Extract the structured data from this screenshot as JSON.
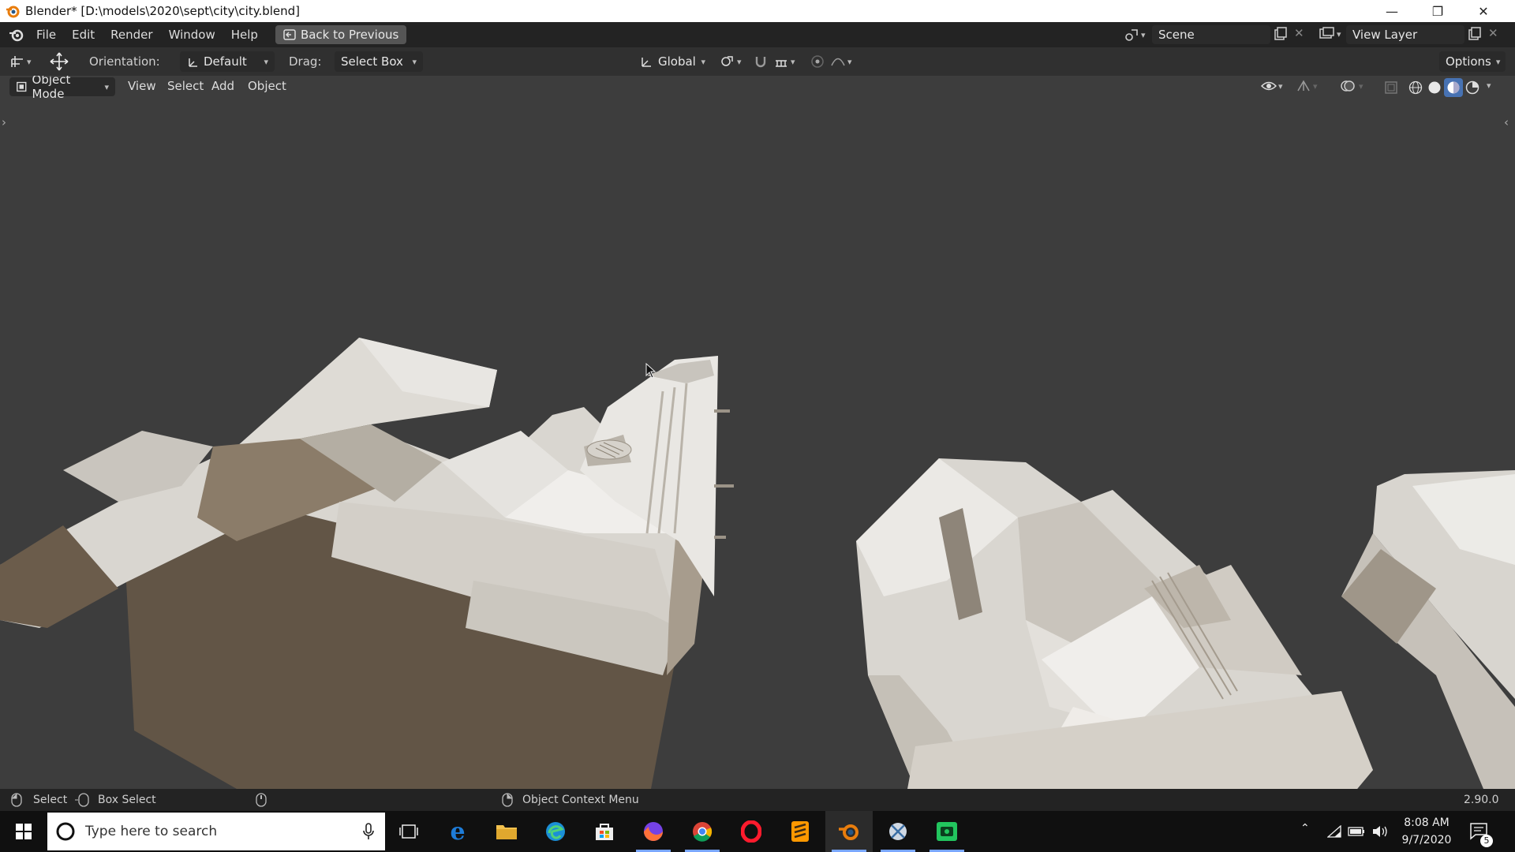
{
  "window": {
    "title": "Blender* [D:\\models\\2020\\sept\\city\\city.blend]"
  },
  "menu": {
    "items": [
      "File",
      "Edit",
      "Render",
      "Window",
      "Help"
    ],
    "back_label": "Back to Previous"
  },
  "scene": {
    "name": "Scene",
    "view_layer": "View Layer"
  },
  "tool_header": {
    "orientation_label": "Orientation:",
    "orientation_value": "Default",
    "drag_label": "Drag:",
    "drag_value": "Select Box",
    "transform_orientation": "Global",
    "options_label": "Options"
  },
  "viewport_header": {
    "mode": "Object Mode",
    "menus": [
      "View",
      "Select",
      "Add",
      "Object"
    ]
  },
  "status": {
    "select": "Select",
    "box_select": "Box Select",
    "context_menu": "Object Context Menu",
    "version": "2.90.0"
  },
  "taskbar": {
    "search_placeholder": "Type here to search",
    "time": "8:08 AM",
    "date": "9/7/2020",
    "notifications": "5"
  },
  "colors": {
    "blender_orange": "#e87d0d",
    "viewport_bg": "#3d3d3d",
    "header_bg": "#303030",
    "active_shading": "#4772b3"
  }
}
